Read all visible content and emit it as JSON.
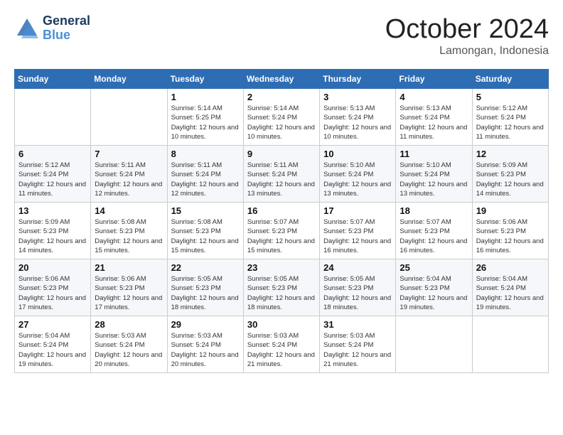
{
  "header": {
    "logo_line1": "General",
    "logo_line2": "Blue",
    "month": "October 2024",
    "location": "Lamongan, Indonesia"
  },
  "days_of_week": [
    "Sunday",
    "Monday",
    "Tuesday",
    "Wednesday",
    "Thursday",
    "Friday",
    "Saturday"
  ],
  "weeks": [
    [
      {
        "day": "",
        "info": ""
      },
      {
        "day": "",
        "info": ""
      },
      {
        "day": "1",
        "info": "Sunrise: 5:14 AM\nSunset: 5:25 PM\nDaylight: 12 hours and 10 minutes."
      },
      {
        "day": "2",
        "info": "Sunrise: 5:14 AM\nSunset: 5:24 PM\nDaylight: 12 hours and 10 minutes."
      },
      {
        "day": "3",
        "info": "Sunrise: 5:13 AM\nSunset: 5:24 PM\nDaylight: 12 hours and 10 minutes."
      },
      {
        "day": "4",
        "info": "Sunrise: 5:13 AM\nSunset: 5:24 PM\nDaylight: 12 hours and 11 minutes."
      },
      {
        "day": "5",
        "info": "Sunrise: 5:12 AM\nSunset: 5:24 PM\nDaylight: 12 hours and 11 minutes."
      }
    ],
    [
      {
        "day": "6",
        "info": "Sunrise: 5:12 AM\nSunset: 5:24 PM\nDaylight: 12 hours and 11 minutes."
      },
      {
        "day": "7",
        "info": "Sunrise: 5:11 AM\nSunset: 5:24 PM\nDaylight: 12 hours and 12 minutes."
      },
      {
        "day": "8",
        "info": "Sunrise: 5:11 AM\nSunset: 5:24 PM\nDaylight: 12 hours and 12 minutes."
      },
      {
        "day": "9",
        "info": "Sunrise: 5:11 AM\nSunset: 5:24 PM\nDaylight: 12 hours and 13 minutes."
      },
      {
        "day": "10",
        "info": "Sunrise: 5:10 AM\nSunset: 5:24 PM\nDaylight: 12 hours and 13 minutes."
      },
      {
        "day": "11",
        "info": "Sunrise: 5:10 AM\nSunset: 5:24 PM\nDaylight: 12 hours and 13 minutes."
      },
      {
        "day": "12",
        "info": "Sunrise: 5:09 AM\nSunset: 5:23 PM\nDaylight: 12 hours and 14 minutes."
      }
    ],
    [
      {
        "day": "13",
        "info": "Sunrise: 5:09 AM\nSunset: 5:23 PM\nDaylight: 12 hours and 14 minutes."
      },
      {
        "day": "14",
        "info": "Sunrise: 5:08 AM\nSunset: 5:23 PM\nDaylight: 12 hours and 15 minutes."
      },
      {
        "day": "15",
        "info": "Sunrise: 5:08 AM\nSunset: 5:23 PM\nDaylight: 12 hours and 15 minutes."
      },
      {
        "day": "16",
        "info": "Sunrise: 5:07 AM\nSunset: 5:23 PM\nDaylight: 12 hours and 15 minutes."
      },
      {
        "day": "17",
        "info": "Sunrise: 5:07 AM\nSunset: 5:23 PM\nDaylight: 12 hours and 16 minutes."
      },
      {
        "day": "18",
        "info": "Sunrise: 5:07 AM\nSunset: 5:23 PM\nDaylight: 12 hours and 16 minutes."
      },
      {
        "day": "19",
        "info": "Sunrise: 5:06 AM\nSunset: 5:23 PM\nDaylight: 12 hours and 16 minutes."
      }
    ],
    [
      {
        "day": "20",
        "info": "Sunrise: 5:06 AM\nSunset: 5:23 PM\nDaylight: 12 hours and 17 minutes."
      },
      {
        "day": "21",
        "info": "Sunrise: 5:06 AM\nSunset: 5:23 PM\nDaylight: 12 hours and 17 minutes."
      },
      {
        "day": "22",
        "info": "Sunrise: 5:05 AM\nSunset: 5:23 PM\nDaylight: 12 hours and 18 minutes."
      },
      {
        "day": "23",
        "info": "Sunrise: 5:05 AM\nSunset: 5:23 PM\nDaylight: 12 hours and 18 minutes."
      },
      {
        "day": "24",
        "info": "Sunrise: 5:05 AM\nSunset: 5:23 PM\nDaylight: 12 hours and 18 minutes."
      },
      {
        "day": "25",
        "info": "Sunrise: 5:04 AM\nSunset: 5:23 PM\nDaylight: 12 hours and 19 minutes."
      },
      {
        "day": "26",
        "info": "Sunrise: 5:04 AM\nSunset: 5:24 PM\nDaylight: 12 hours and 19 minutes."
      }
    ],
    [
      {
        "day": "27",
        "info": "Sunrise: 5:04 AM\nSunset: 5:24 PM\nDaylight: 12 hours and 19 minutes."
      },
      {
        "day": "28",
        "info": "Sunrise: 5:03 AM\nSunset: 5:24 PM\nDaylight: 12 hours and 20 minutes."
      },
      {
        "day": "29",
        "info": "Sunrise: 5:03 AM\nSunset: 5:24 PM\nDaylight: 12 hours and 20 minutes."
      },
      {
        "day": "30",
        "info": "Sunrise: 5:03 AM\nSunset: 5:24 PM\nDaylight: 12 hours and 21 minutes."
      },
      {
        "day": "31",
        "info": "Sunrise: 5:03 AM\nSunset: 5:24 PM\nDaylight: 12 hours and 21 minutes."
      },
      {
        "day": "",
        "info": ""
      },
      {
        "day": "",
        "info": ""
      }
    ]
  ]
}
